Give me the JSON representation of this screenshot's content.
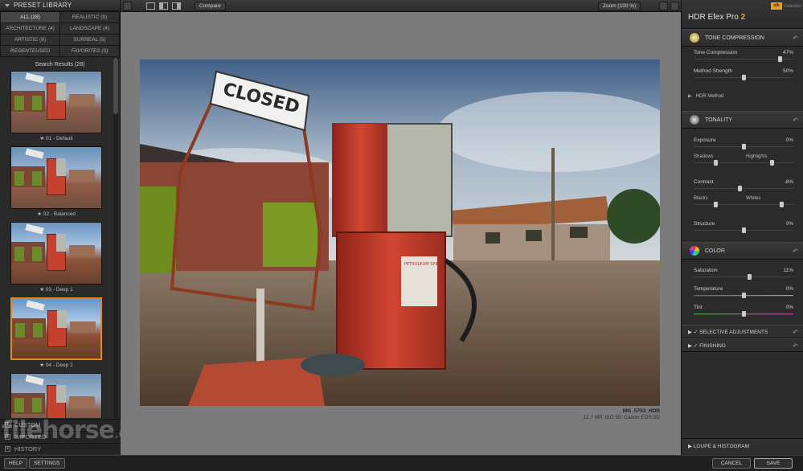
{
  "left_panel": {
    "title": "PRESET LIBRARY",
    "filters": [
      {
        "label": "ALL (28)"
      },
      {
        "label": "REALISTIC (9)"
      },
      {
        "label": "ARCHITECTURE (4)"
      },
      {
        "label": "LANDSCAPE (4)"
      },
      {
        "label": "ARTISTIC (6)"
      },
      {
        "label": "SURREAL (5)"
      },
      {
        "label": "REGENTEUSED"
      },
      {
        "label": "FAVORITES (0)"
      }
    ],
    "results_header": "Search Results (28)",
    "presets": [
      {
        "label": "★ 01 - Default"
      },
      {
        "label": "★ 02 - Balanced"
      },
      {
        "label": "★ 03 - Deep 1"
      },
      {
        "label": "★ 04 - Deep 2"
      },
      {
        "label": ""
      }
    ],
    "sections": [
      {
        "label": "CUSTOM"
      },
      {
        "label": "IMPORTED"
      },
      {
        "label": "HISTORY"
      }
    ]
  },
  "toolbar": {
    "compare_label": "Compare",
    "zoom_label": "Zoom (100 %)"
  },
  "photo": {
    "filename": "_MG_5753_HDR",
    "meta": "12.7 MP, ISO 50, Canon EOS 5D",
    "sign_text": "CLOSED",
    "pump_text": "PETROLEUM SPIRIT"
  },
  "right_panel": {
    "app_name": "HDR Efex Pro",
    "app_version": "2",
    "brand_mark": "nik",
    "brand_caption": "Collection",
    "tone": {
      "title": "TONE COMPRESSION",
      "tone_compression": {
        "label": "Tone Compression",
        "value": "47%",
        "level": 0.86
      },
      "method_strength": {
        "label": "Method Strength",
        "value": "50%",
        "level": 0.5
      },
      "hdr_method": "HDR Method"
    },
    "tonality": {
      "title": "TONALITY",
      "exposure": {
        "label": "Exposure",
        "value": "0%",
        "level": 0.5
      },
      "shadows": {
        "label": "Shadows",
        "level": 0.22
      },
      "highlights": {
        "label": "Highlights",
        "level": 0.78
      },
      "contrast": {
        "label": "Contrast",
        "value": "-8%",
        "level": 0.46
      },
      "blacks": {
        "label": "Blacks",
        "level": 0.22
      },
      "whites": {
        "label": "Whites",
        "level": 0.88
      },
      "structure": {
        "label": "Structure",
        "value": "0%",
        "level": 0.5
      }
    },
    "color": {
      "title": "COLOR",
      "saturation": {
        "label": "Saturation",
        "value": "11%",
        "level": 0.56
      },
      "temperature": {
        "label": "Temperature",
        "value": "0%",
        "level": 0.5
      },
      "tint": {
        "label": "Tint",
        "value": "0%",
        "level": 0.5
      }
    },
    "selective": "SELECTIVE ADJUSTMENTS",
    "finishing": "FINISHING",
    "loupe": "LOUPE & HISTOGRAM"
  },
  "bottom": {
    "help": "HELP",
    "settings": "SETTINGS",
    "cancel": "CANCEL",
    "save": "SAVE"
  },
  "watermark": {
    "main": "filehorse",
    "tld": ".com"
  }
}
